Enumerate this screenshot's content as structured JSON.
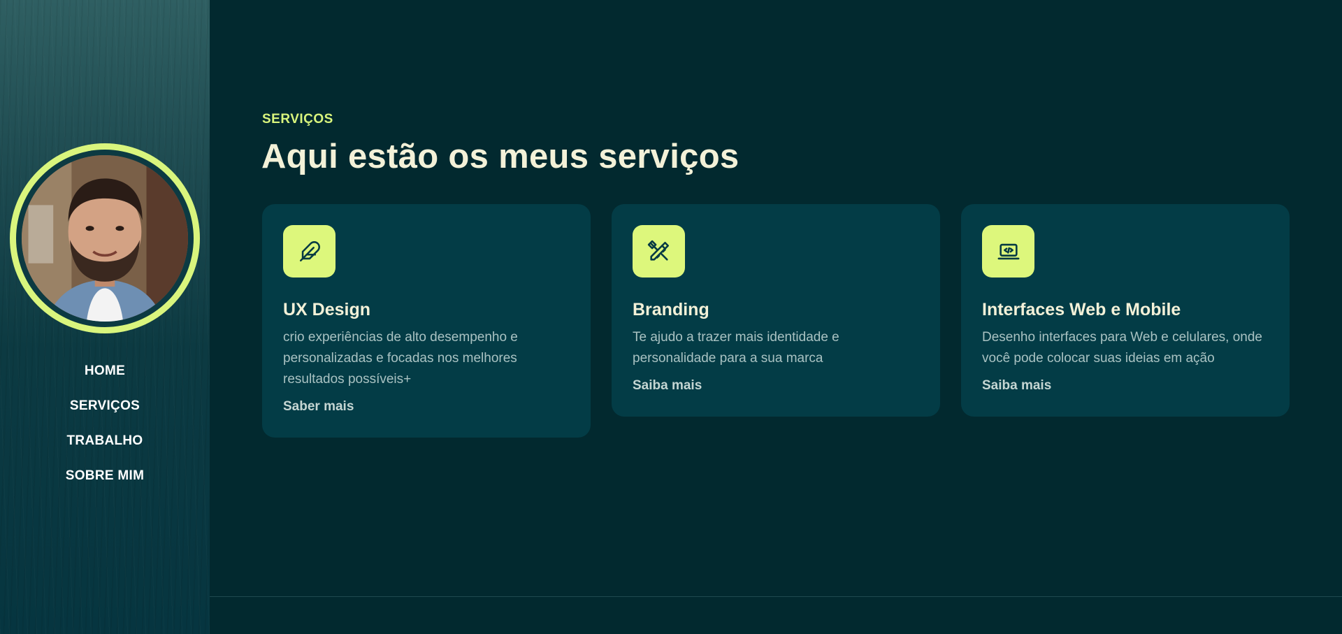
{
  "nav": {
    "items": [
      {
        "label": "HOME"
      },
      {
        "label": "SERVIÇOS"
      },
      {
        "label": "TRABALHO"
      },
      {
        "label": "SOBRE MIM"
      }
    ]
  },
  "services": {
    "eyebrow": "SERVIÇOS",
    "heading": "Aqui estão os meus serviços",
    "cards": [
      {
        "icon": "feather-icon",
        "title": "UX Design",
        "description": "crio experiências de alto desempenho e personalizadas e focadas nos melhores resultados possíveis+",
        "link": "Saber mais"
      },
      {
        "icon": "pencil-ruler-icon",
        "title": "Branding",
        "description": "Te ajudo a trazer mais identidade e personalidade para a sua marca",
        "link": "Saiba mais"
      },
      {
        "icon": "laptop-code-icon",
        "title": "Interfaces Web e Mobile",
        "description": "Desenho interfaces para Web e celulares, onde você pode colocar suas ideias em ação",
        "link": "Saiba mais"
      }
    ]
  },
  "colors": {
    "accent": "#d9f57d",
    "background": "#02292f",
    "card": "#033c46",
    "heading": "#f3f1d8"
  }
}
